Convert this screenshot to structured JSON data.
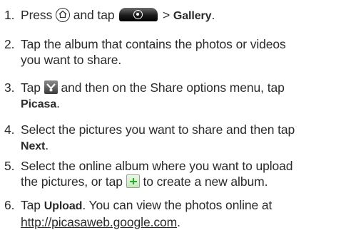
{
  "steps": [
    {
      "num": "1.",
      "t1": "Press",
      "t2": "and tap",
      "t3": "> ",
      "b1": "Gallery",
      "t4": "."
    },
    {
      "num": "2.",
      "l1": "Tap the album that contains the photos or videos",
      "l2": "you want to share."
    },
    {
      "num": "3.",
      "t1": "Tap",
      "t2": "and then on the Share options menu, tap",
      "b1": "Picasa",
      "t3": "."
    },
    {
      "num": "4.",
      "l1": "Select the pictures you want to share and then tap",
      "b1": "Next",
      "t1": "."
    },
    {
      "num": "5.",
      "l1": "Select the online album where you want to upload",
      "t1": "the pictures, or tap",
      "t2": "to create a new album."
    },
    {
      "num": "6.",
      "t1": "Tap",
      "b1": "Upload",
      "t2": ". You can view the photos online at",
      "link": "http://picasaweb.google.com",
      "t3": "."
    }
  ],
  "icons": {
    "home": "home-icon",
    "launcher": "all-apps-launcher-icon",
    "share": "share-icon",
    "plus": "add-album-icon"
  }
}
